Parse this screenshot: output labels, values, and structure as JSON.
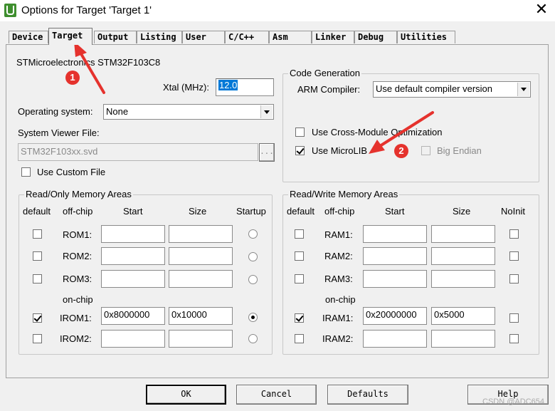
{
  "window": {
    "title": "Options for Target 'Target 1'",
    "close_glyph": "✕"
  },
  "tabs": [
    {
      "label": "Device"
    },
    {
      "label": "Target"
    },
    {
      "label": "Output"
    },
    {
      "label": "Listing"
    },
    {
      "label": "User"
    },
    {
      "label": "C/C++"
    },
    {
      "label": "Asm"
    },
    {
      "label": "Linker"
    },
    {
      "label": "Debug"
    },
    {
      "label": "Utilities"
    }
  ],
  "target": {
    "device_name": "STMicroelectronics STM32F103C8",
    "xtal_label": "Xtal (MHz):",
    "xtal_value": "12.0",
    "os_label": "Operating system:",
    "os_value": "None",
    "svf_label": "System Viewer File:",
    "svf_value": "STM32F103xx.svd",
    "browse_label": "...",
    "use_custom_file": "Use Custom File"
  },
  "code_generation": {
    "title": "Code Generation",
    "compiler_label": "ARM Compiler:",
    "compiler_value": "Use default compiler version",
    "cross_module": "Use Cross-Module Optimization",
    "microlib": "Use MicroLIB",
    "big_endian": "Big Endian"
  },
  "ro_memory": {
    "title": "Read/Only Memory Areas",
    "headers": {
      "default": "default",
      "offchip": "off-chip",
      "start": "Start",
      "size": "Size",
      "startup": "Startup"
    },
    "onchip_label": "on-chip",
    "rows": [
      {
        "name": "ROM1:",
        "start": "",
        "size": ""
      },
      {
        "name": "ROM2:",
        "start": "",
        "size": ""
      },
      {
        "name": "ROM3:",
        "start": "",
        "size": ""
      },
      {
        "name": "IROM1:",
        "start": "0x8000000",
        "size": "0x10000"
      },
      {
        "name": "IROM2:",
        "start": "",
        "size": ""
      }
    ]
  },
  "rw_memory": {
    "title": "Read/Write Memory Areas",
    "headers": {
      "default": "default",
      "offchip": "off-chip",
      "start": "Start",
      "size": "Size",
      "noinit": "NoInit"
    },
    "onchip_label": "on-chip",
    "rows": [
      {
        "name": "RAM1:",
        "start": "",
        "size": ""
      },
      {
        "name": "RAM2:",
        "start": "",
        "size": ""
      },
      {
        "name": "RAM3:",
        "start": "",
        "size": ""
      },
      {
        "name": "IRAM1:",
        "start": "0x20000000",
        "size": "0x5000"
      },
      {
        "name": "IRAM2:",
        "start": "",
        "size": ""
      }
    ]
  },
  "buttons": {
    "ok": "OK",
    "cancel": "Cancel",
    "defaults": "Defaults",
    "help": "Help"
  },
  "annotations": {
    "badge1": "1",
    "badge2": "2",
    "color": "#e5322d"
  },
  "watermark": "CSDN @ADC654"
}
